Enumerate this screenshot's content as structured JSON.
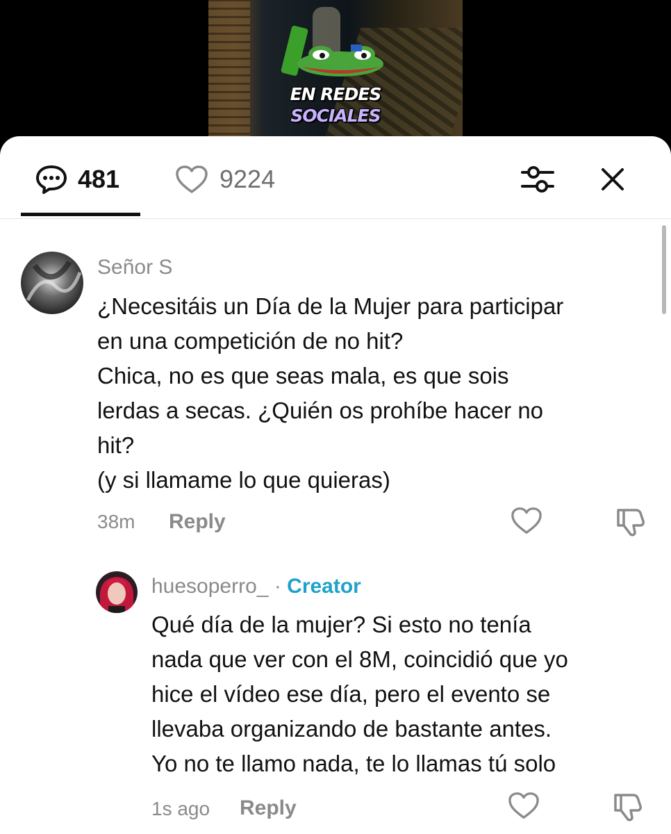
{
  "video": {
    "caption_line1": "EN REDES",
    "caption_line2": "SOCIALES"
  },
  "header": {
    "comment_count": "481",
    "like_count": "9224",
    "comment_icon": "comment-bubble-icon",
    "like_icon": "heart-outline-icon",
    "filter_icon": "sliders-icon",
    "close_icon": "close-icon"
  },
  "comments": [
    {
      "username": "Señor S",
      "text": "¿Necesitáis un Día de la Mujer para participar\nen una competición de no hit?\nChica, no es que seas mala, es que sois\nlerdas a secas. ¿Quién os prohíbe hacer no\nhit?\n(y si llamame lo que quieras)",
      "time": "38m",
      "reply_label": "Reply"
    },
    {
      "username": "huesoperro_",
      "separator": "·",
      "badge": "Creator",
      "text": "Qué día de la mujer? Si esto no tenía\nnada que ver con el 8M, coincidió que yo\nhice el vídeo ese día, pero el evento se\nllevaba organizando de bastante antes.\nYo no te llamo nada, te lo llamas tú solo",
      "time": "1s ago",
      "reply_label": "Reply"
    }
  ],
  "colors": {
    "accent_creator": "#1fa2c9",
    "muted_text": "#8a8a8a",
    "primary_text": "#111111"
  }
}
